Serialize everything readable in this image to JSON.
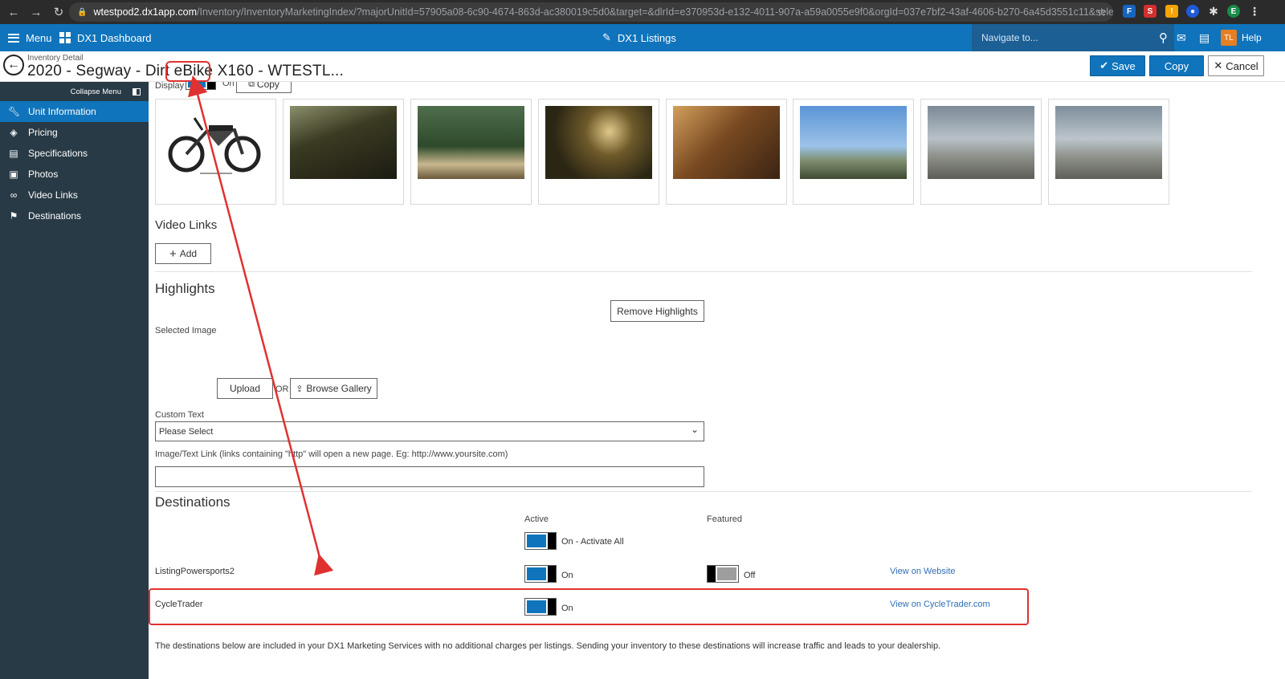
{
  "browser": {
    "url_host": "wtestpod2.dx1app.com",
    "url_path": "/Inventory/InventoryMarketingIndex/?majorUnitId=57905a08-6c90-4674-863d-ac380019c5d0&target=&dlrId=e370953d-e132-4011-907a-a59a0055e9f0&orgId=037e7bf2-43af-4606-b270-6a45d3551c11&selecteditem...",
    "avatar_letter": "E"
  },
  "header": {
    "menu_label": "Menu",
    "dashboard_label": "DX1 Dashboard",
    "listings_label": "DX1 Listings",
    "navigate_placeholder": "Navigate to...",
    "user_initials": "TL",
    "help_label": "Help"
  },
  "subheader": {
    "breadcrumb": "Inventory Detail",
    "title": "2020 - Segway - Dirt eBike X160 - WTESTL...",
    "save_label": "Save",
    "copy_label": "Copy",
    "cancel_label": "Cancel"
  },
  "sidebar": {
    "collapse_label": "Collapse Menu",
    "items": [
      {
        "label": "Unit Information",
        "icon": "wrench-icon",
        "active": true
      },
      {
        "label": "Pricing",
        "icon": "tag-icon",
        "active": false
      },
      {
        "label": "Specifications",
        "icon": "document-icon",
        "active": false
      },
      {
        "label": "Photos",
        "icon": "image-icon",
        "active": false
      },
      {
        "label": "Video Links",
        "icon": "link-icon",
        "active": false
      },
      {
        "label": "Destinations",
        "icon": "flag-icon",
        "active": false
      }
    ]
  },
  "photos": {
    "display_label": "Display",
    "display_state": "On",
    "copy_label": "Copy",
    "count": 8
  },
  "video_links": {
    "title": "Video Links",
    "add_label": "Add"
  },
  "highlights": {
    "title": "Highlights",
    "remove_label": "Remove Highlights",
    "selected_image_label": "Selected Image",
    "upload_label": "Upload",
    "or_label": "OR",
    "browse_label": "Browse Gallery",
    "custom_text_label": "Custom Text",
    "custom_text_value": "Please Select",
    "link_label": "Image/Text Link (links containing \"http\" will open a new page. Eg: http://www.yoursite.com)",
    "link_value": ""
  },
  "destinations": {
    "title": "Destinations",
    "active_header": "Active",
    "featured_header": "Featured",
    "activate_all_label": "On - Activate All",
    "rows": [
      {
        "name": "ListingPowersports2",
        "active_label": "On",
        "featured_label": "Off",
        "link": "View on Website"
      },
      {
        "name": "CycleTrader",
        "active_label": "On",
        "featured_label": "",
        "link": "View on CycleTrader.com"
      }
    ],
    "footer_note": "The destinations below are included in your DX1 Marketing Services with no additional charges per listings. Sending your inventory to these destinations will increase traffic and leads to your dealership."
  },
  "colors": {
    "brand_blue": "#0f74bc",
    "sidebar_bg": "#283a46",
    "annotation_red": "#e03131"
  }
}
